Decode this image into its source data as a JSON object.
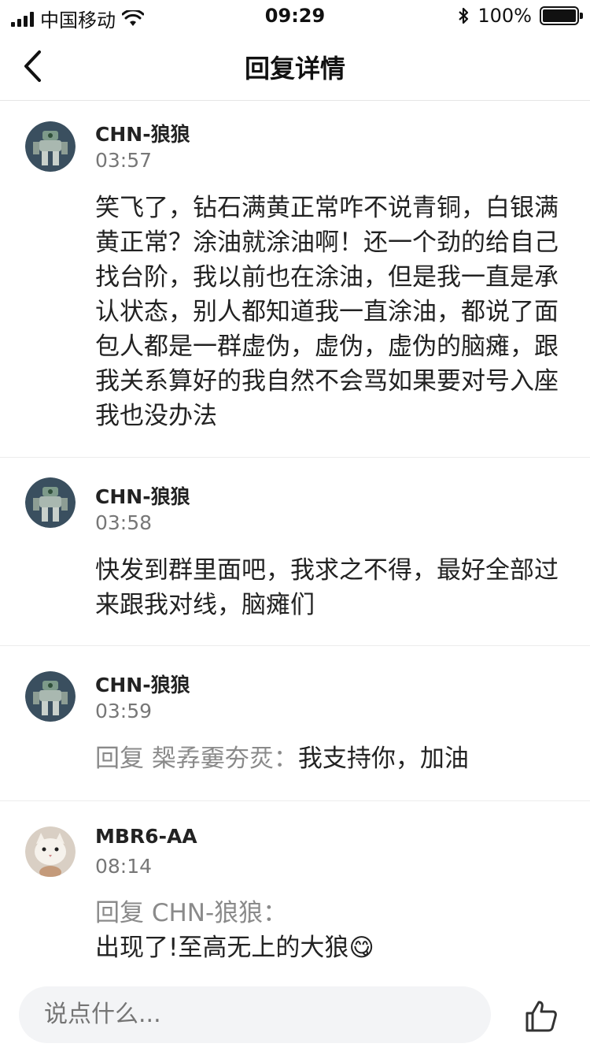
{
  "status_bar": {
    "carrier": "中国移动",
    "time": "09:29",
    "battery": "100%"
  },
  "nav": {
    "title": "回复详情",
    "back_icon": "chevron-left-icon"
  },
  "comments": [
    {
      "user": "CHN-狼狼",
      "time": "03:57",
      "avatar": "robot-mech-avatar",
      "reply_prefix": "",
      "text": "笑飞了，钻石满黄正常咋不说青铜，白银满黄正常？涂油就涂油啊！还一个劲的给自己找台阶，我以前也在涂油，但是我一直是承认状态，别人都知道我一直涂油，都说了面包人都是一群虚伪，虚伪，虚伪的脑瘫，跟我关系算好的我自然不会骂如果要对号入座我也没办法"
    },
    {
      "user": "CHN-狼狼",
      "time": "03:58",
      "avatar": "robot-mech-avatar",
      "reply_prefix": "",
      "text": "快发到群里面吧，我求之不得，最好全部过来跟我对线，脑瘫们"
    },
    {
      "user": "CHN-狼狼",
      "time": "03:59",
      "avatar": "robot-mech-avatar",
      "reply_prefix": "回复 椝孨嫑夯烎：",
      "text": "我支持你，加油"
    },
    {
      "user": "MBR6-AA",
      "time": "08:14",
      "avatar": "cat-avatar",
      "reply_prefix": "回复 CHN-狼狼：",
      "text": "出现了!至高无上的大狼",
      "emoji": "😋"
    }
  ],
  "input": {
    "placeholder": "说点什么..."
  },
  "icons": {
    "like": "thumbs-up-icon"
  }
}
